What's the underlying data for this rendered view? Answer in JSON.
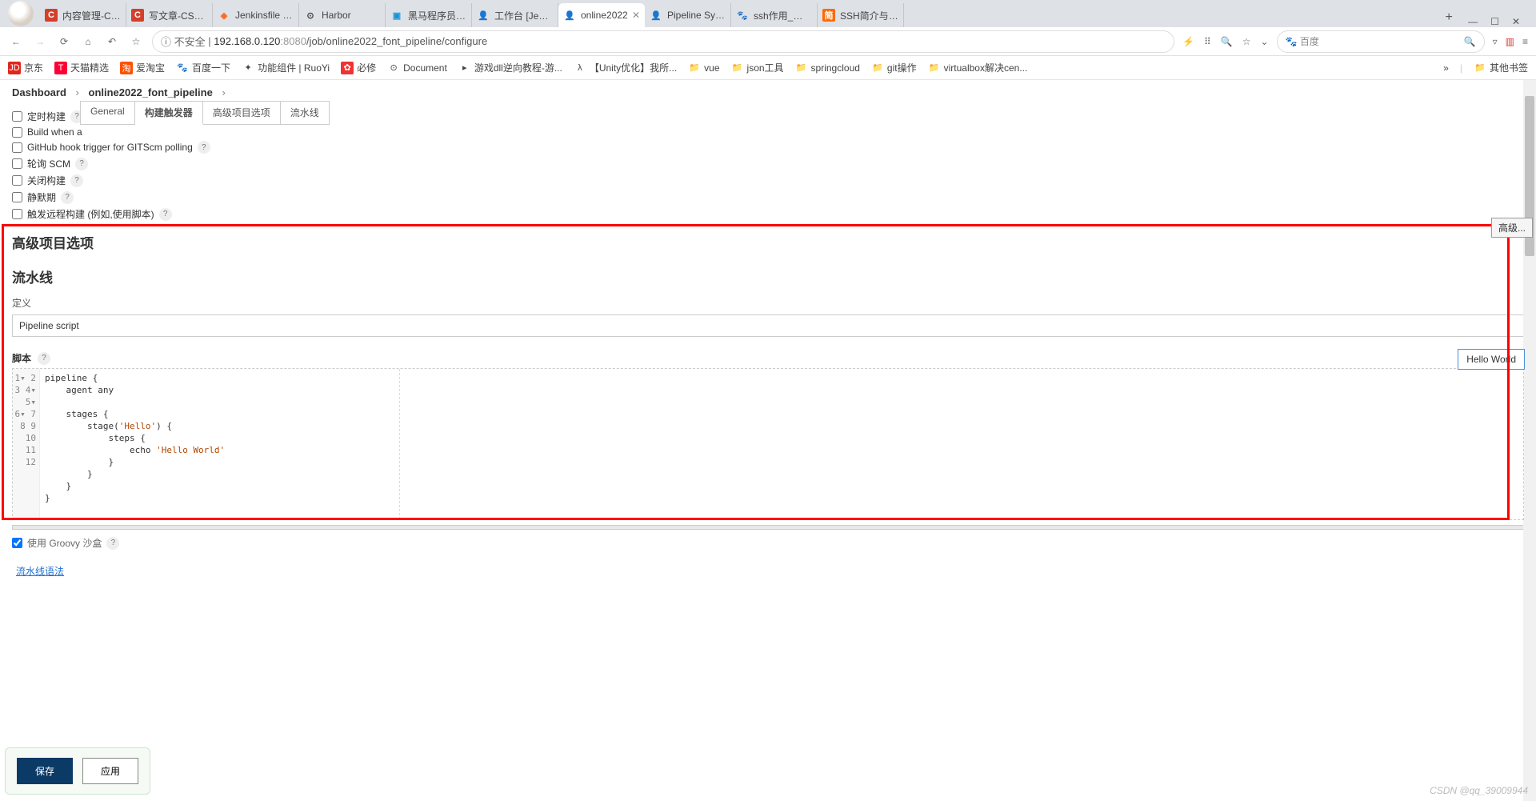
{
  "browser": {
    "tabs": [
      {
        "favicon": "C",
        "favclass": "fav-c",
        "title": "内容管理-CSDN"
      },
      {
        "favicon": "C",
        "favclass": "fav-c",
        "title": "写文章-CSDN"
      },
      {
        "favicon": "◆",
        "favclass": "fav-gl",
        "title": "Jenkinsfile · m"
      },
      {
        "favicon": "⊙",
        "favclass": "",
        "title": "Harbor"
      },
      {
        "favicon": "▣",
        "favclass": "fav-bb",
        "title": "黑马程序员Jav"
      },
      {
        "favicon": "👤",
        "favclass": "fav-je",
        "title": "工作台 [Jenkin"
      },
      {
        "favicon": "👤",
        "favclass": "fav-je",
        "title": "online2022",
        "active": true
      },
      {
        "favicon": "👤",
        "favclass": "fav-je",
        "title": "Pipeline Synta"
      },
      {
        "favicon": "🐾",
        "favclass": "fav-bd",
        "title": "ssh作用_百度搜"
      },
      {
        "favicon": "简",
        "favclass": "fav-or",
        "title": "SSH简介与用法"
      }
    ],
    "url_prefix": "不安全",
    "url_host": "192.168.0.120",
    "url_port": ":8080",
    "url_path": "/job/online2022_font_pipeline/configure",
    "search_engine": "百度"
  },
  "bookmarks": [
    {
      "icon": "JD",
      "cls": "",
      "text": "京东",
      "bg": "#e1251b"
    },
    {
      "icon": "T",
      "cls": "",
      "text": "天猫精选",
      "bg": "#ff0036"
    },
    {
      "icon": "淘",
      "cls": "",
      "text": "爱淘宝",
      "bg": "#ff5000"
    },
    {
      "icon": "🐾",
      "cls": "",
      "text": "百度一下",
      "bg": ""
    },
    {
      "icon": "✦",
      "cls": "",
      "text": "功能组件 | RuoYi",
      "bg": ""
    },
    {
      "icon": "✿",
      "cls": "",
      "text": "必修",
      "bg": "#e33"
    },
    {
      "icon": "⊙",
      "cls": "",
      "text": "Document",
      "bg": ""
    },
    {
      "icon": "▸",
      "cls": "",
      "text": "游戏dll逆向教程-游...",
      "bg": ""
    },
    {
      "icon": "λ",
      "cls": "",
      "text": "【Unity优化】我所...",
      "bg": ""
    },
    {
      "icon": "📁",
      "cls": "folder-icon",
      "text": "vue",
      "bg": ""
    },
    {
      "icon": "📁",
      "cls": "folder-icon",
      "text": "json工具",
      "bg": ""
    },
    {
      "icon": "📁",
      "cls": "folder-icon",
      "text": "springcloud",
      "bg": ""
    },
    {
      "icon": "📁",
      "cls": "folder-icon",
      "text": "git操作",
      "bg": ""
    },
    {
      "icon": "📁",
      "cls": "folder-icon",
      "text": "virtualbox解决cen...",
      "bg": ""
    }
  ],
  "bookmarks_right": {
    "icon": "📁",
    "text": "其他书签"
  },
  "breadcrumb": {
    "dashboard": "Dashboard",
    "job": "online2022_font_pipeline"
  },
  "config_tabs": [
    "General",
    "构建触发器",
    "高级项目选项",
    "流水线"
  ],
  "config_active": 1,
  "triggers": [
    {
      "label": "定时构建",
      "help": true
    },
    {
      "label": "Build when a",
      "help": false
    },
    {
      "label": "GitHub hook trigger for GITScm polling",
      "help": true
    },
    {
      "label": "轮询 SCM",
      "help": true
    },
    {
      "label": "关闭构建",
      "help": true
    },
    {
      "label": "静默期",
      "help": true
    },
    {
      "label": "触发远程构建 (例如,使用脚本)",
      "help": true
    }
  ],
  "sections": {
    "advanced": "高级项目选项",
    "adv_button": "高级...",
    "pipeline": "流水线",
    "definition_label": "定义",
    "definition_value": "Pipeline script",
    "script_label": "脚本",
    "sample": "Hello World",
    "sandbox_label": "使用 Groovy 沙盒",
    "syntax_link": "流水线语法"
  },
  "code": {
    "lines": [
      {
        "n": "1",
        "fold": "▾",
        "text": "pipeline {"
      },
      {
        "n": "2",
        "fold": "",
        "text": "    agent any"
      },
      {
        "n": "3",
        "fold": "",
        "text": ""
      },
      {
        "n": "4",
        "fold": "▾",
        "text": "    stages {"
      },
      {
        "n": "5",
        "fold": "▾",
        "text": "        stage('Hello') {"
      },
      {
        "n": "6",
        "fold": "▾",
        "text": "            steps {"
      },
      {
        "n": "7",
        "fold": "",
        "text": "                echo 'Hello World'"
      },
      {
        "n": "8",
        "fold": "",
        "text": "            }"
      },
      {
        "n": "9",
        "fold": "",
        "text": "        }"
      },
      {
        "n": "10",
        "fold": "",
        "text": "    }"
      },
      {
        "n": "11",
        "fold": "",
        "text": "}"
      },
      {
        "n": "12",
        "fold": "",
        "text": ""
      }
    ]
  },
  "buttons": {
    "save": "保存",
    "apply": "应用"
  },
  "watermark": "CSDN @qq_39009944"
}
